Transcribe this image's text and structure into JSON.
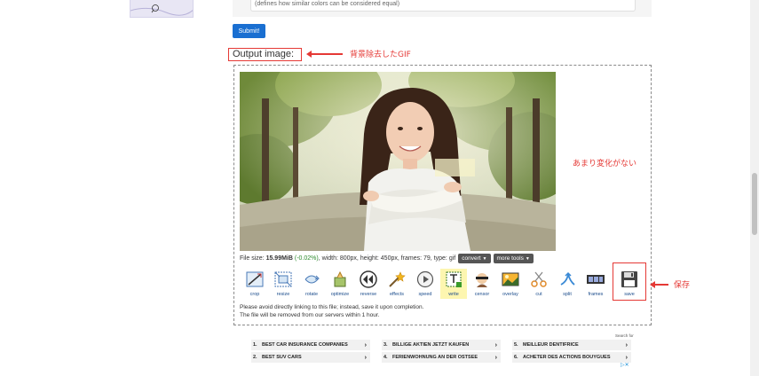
{
  "form": {
    "tolerance_hint": "(defines how similar colors can be considered equal)",
    "submit_label": "Submit!"
  },
  "output": {
    "title": "Output image:"
  },
  "annotations": {
    "gif_note": "背景除去したGIF",
    "no_change_note": "あまり変化がない",
    "save_note": "保存"
  },
  "file_info": {
    "prefix": "File size: ",
    "size": "15.99MiB",
    "delta": "(-0.02%)",
    "details": ", width: 800px, height: 450px, frames: 79, type: gif",
    "convert_label": "convert",
    "more_tools_label": "more tools"
  },
  "tools": [
    {
      "label": "crop",
      "icon": "crop-icon"
    },
    {
      "label": "resize",
      "icon": "resize-icon"
    },
    {
      "label": "rotate",
      "icon": "rotate-icon"
    },
    {
      "label": "optimize",
      "icon": "optimize-icon"
    },
    {
      "label": "reverse",
      "icon": "reverse-icon"
    },
    {
      "label": "effects",
      "icon": "effects-icon"
    },
    {
      "label": "speed",
      "icon": "speed-icon"
    },
    {
      "label": "write",
      "icon": "write-icon",
      "active": true
    },
    {
      "label": "censor",
      "icon": "censor-icon"
    },
    {
      "label": "overlay",
      "icon": "overlay-icon"
    },
    {
      "label": "cut",
      "icon": "cut-icon"
    },
    {
      "label": "split",
      "icon": "split-icon"
    },
    {
      "label": "frames",
      "icon": "frames-icon"
    },
    {
      "label": "save",
      "icon": "save-icon"
    }
  ],
  "notice": {
    "line1": "Please avoid directly linking to this file; instead, save it upon completion.",
    "line2": "The file will be removed from our servers within 1 hour."
  },
  "ads": {
    "label": "Search for",
    "items": [
      {
        "num": "1.",
        "text": "BEST CAR INSURANCE COMPANIES"
      },
      {
        "num": "3.",
        "text": "BILLIGE AKTIEN JETZT KAUFEN"
      },
      {
        "num": "5.",
        "text": "MEILLEUR DENTIFRICE"
      },
      {
        "num": "2.",
        "text": "BEST SUV CARS"
      },
      {
        "num": "4.",
        "text": "FERIENWOHNUNG AN DER OSTSEE"
      },
      {
        "num": "6.",
        "text": "ACHETER DES ACTIONS BOUYGUES"
      }
    ]
  },
  "colors": {
    "accent_red": "#e53935",
    "submit_blue": "#1a6fd1",
    "link_blue": "#1b4c8c",
    "delta_green": "#2e8b2e"
  }
}
